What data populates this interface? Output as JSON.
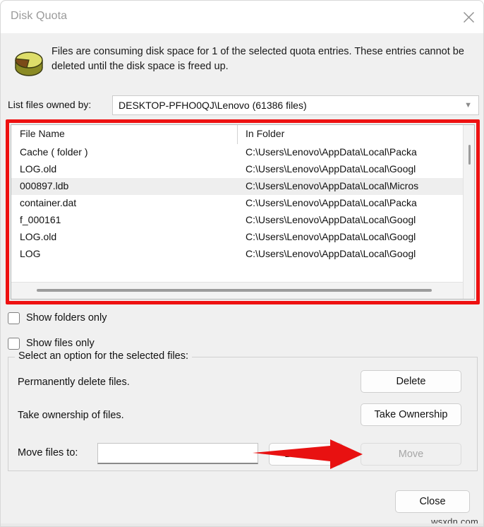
{
  "window": {
    "title": "Disk Quota",
    "close_icon": "close-icon"
  },
  "message": {
    "text": "Files are consuming disk space for 1 of the selected quota entries.  These entries cannot be deleted until the disk space is freed up.",
    "icon": "disk-quota-pie-icon"
  },
  "owner": {
    "label": "List files owned by:",
    "value": "DESKTOP-PFHO0QJ\\Lenovo (61386 files)",
    "chevron_icon": "chevron-down-icon"
  },
  "filelist": {
    "columns": [
      "File Name",
      "In Folder"
    ],
    "rows": [
      {
        "name": "Cache  ( folder )",
        "folder": "C:\\Users\\Lenovo\\AppData\\Local\\Packa",
        "selected": false
      },
      {
        "name": "LOG.old",
        "folder": "C:\\Users\\Lenovo\\AppData\\Local\\Googl",
        "selected": false
      },
      {
        "name": "000897.ldb",
        "folder": "C:\\Users\\Lenovo\\AppData\\Local\\Micros",
        "selected": true
      },
      {
        "name": "container.dat",
        "folder": "C:\\Users\\Lenovo\\AppData\\Local\\Packa",
        "selected": false
      },
      {
        "name": "f_000161",
        "folder": "C:\\Users\\Lenovo\\AppData\\Local\\Googl",
        "selected": false
      },
      {
        "name": "LOG.old",
        "folder": "C:\\Users\\Lenovo\\AppData\\Local\\Googl",
        "selected": false
      },
      {
        "name": "LOG",
        "folder": "C:\\Users\\Lenovo\\AppData\\Local\\Googl",
        "selected": false
      }
    ]
  },
  "checkboxes": [
    {
      "label": "Show folders only",
      "checked": false
    },
    {
      "label": "Show files only",
      "checked": false
    }
  ],
  "options_group": {
    "legend": "Select an option for the selected files:",
    "delete_text": "Permanently delete files.",
    "delete_button": "Delete",
    "ownership_text": "Take ownership of files.",
    "ownership_button": "Take Ownership",
    "move_label": "Move files to:",
    "move_value": "",
    "browse_button": "Browse...",
    "move_button": "Move"
  },
  "footer": {
    "close_button": "Close",
    "watermark": "wsxdn.com"
  },
  "annotations": {
    "highlight_color": "#ee1111",
    "arrow_color": "#e81111",
    "arrow_name": "red-arrow-annotation",
    "highlight_name": "red-box-annotation"
  }
}
